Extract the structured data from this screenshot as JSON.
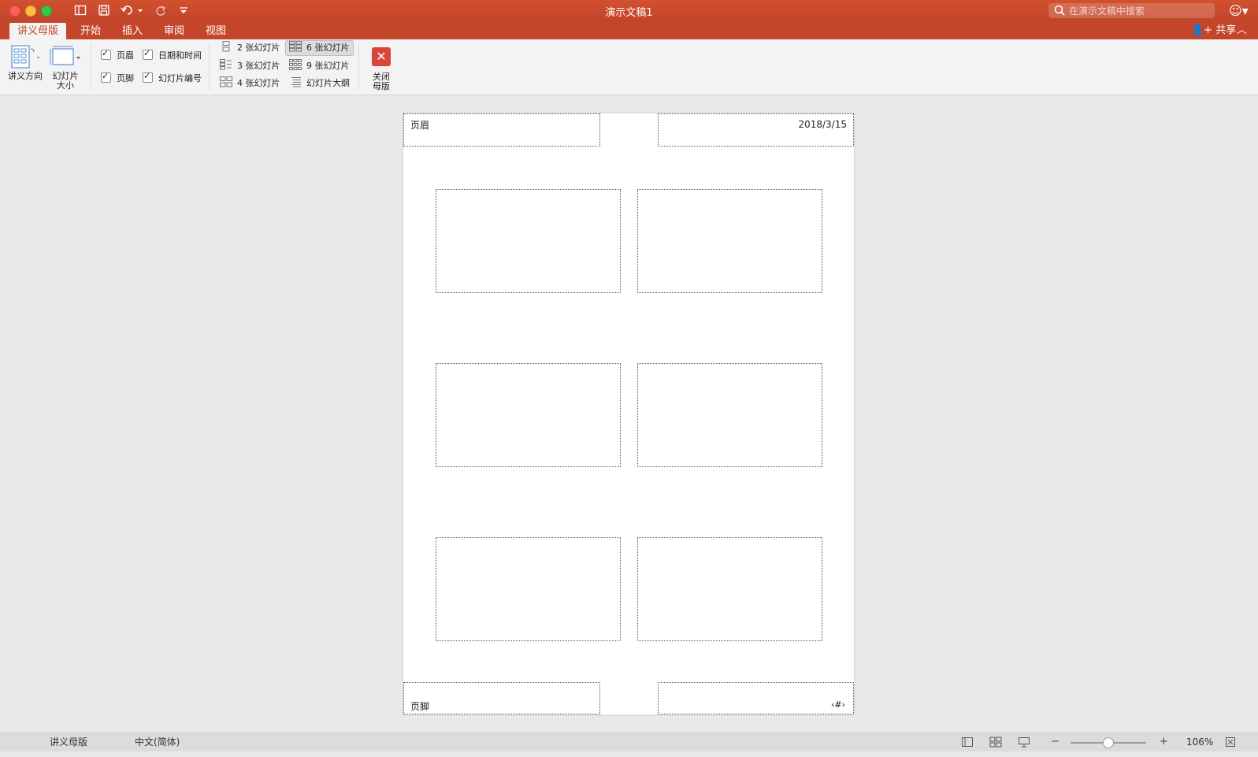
{
  "window": {
    "title": "演示文稿1",
    "search_placeholder": "在演示文稿中搜索",
    "share_label": "共享"
  },
  "tabs": [
    {
      "label": "讲义母版",
      "active": true
    },
    {
      "label": "开始",
      "active": false
    },
    {
      "label": "插入",
      "active": false
    },
    {
      "label": "审阅",
      "active": false
    },
    {
      "label": "视图",
      "active": false
    }
  ],
  "ribbon": {
    "orientation_label": "讲义方向",
    "slide_size_label_1": "幻灯片",
    "slide_size_label_2": "大小",
    "checkboxes": {
      "header": {
        "label": "页眉",
        "checked": true
      },
      "date": {
        "label": "日期和时间",
        "checked": true
      },
      "footer": {
        "label": "页脚",
        "checked": true
      },
      "slide_number": {
        "label": "幻灯片编号",
        "checked": true
      }
    },
    "layouts": {
      "two": "2 张幻灯片",
      "three": "3 张幻灯片",
      "four": "4 张幻灯片",
      "six": "6 张幻灯片",
      "nine": "9 张幻灯片",
      "outline": "幻灯片大纲",
      "selected": "6 张幻灯片"
    },
    "close_label_1": "关闭",
    "close_label_2": "母版"
  },
  "page": {
    "header_text": "页眉",
    "date_text": "2018/3/15",
    "footer_text": "页脚",
    "number_text": "‹#›",
    "slides_per_page": 6
  },
  "status": {
    "view_name": "讲义母版",
    "language": "中文(简体)",
    "zoom": "106%",
    "zoom_level": 0.5
  },
  "colors": {
    "accent": "#c3452a",
    "close_button": "#d9443d"
  }
}
